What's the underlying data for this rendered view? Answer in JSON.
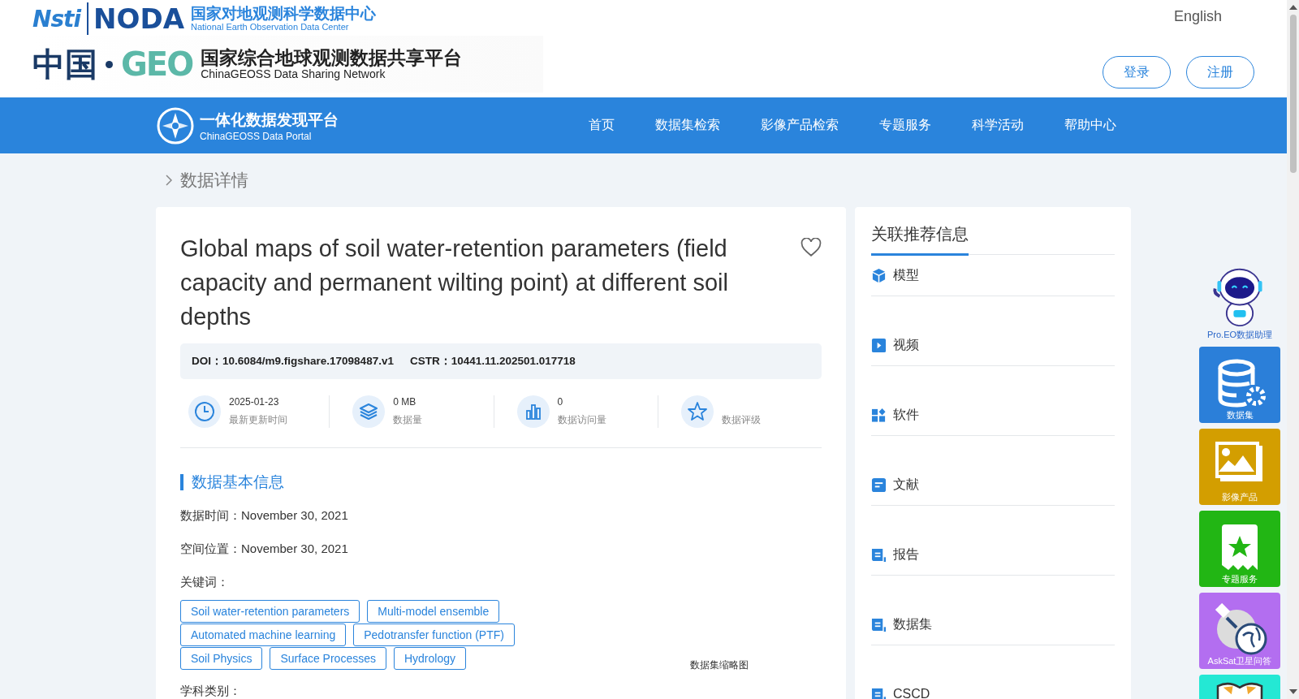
{
  "header": {
    "logos": {
      "nsti": "Nsti",
      "noda": "NODA",
      "noda_cn": "国家对地观测科学数据中心",
      "noda_en": "National Earth Observation Data Center",
      "china": "中国",
      "geo": "GEO",
      "geo_cn": "国家综合地球观测数据共享平台",
      "geo_en": "ChinaGEOSS Data Sharing Network"
    },
    "language": "English",
    "buttons": [
      "登录",
      "注册"
    ]
  },
  "nav": {
    "brand": {
      "title": "一体化数据发现平台",
      "subtitle": "ChinaGEOSS Data Portal"
    },
    "items": [
      "首页",
      "数据集检索",
      "影像产品检索",
      "专题服务",
      "科学活动",
      "帮助中心"
    ]
  },
  "breadcrumb": "数据详情",
  "dataset": {
    "title": "Global maps of soil water-retention parameters (field capacity and permanent wilting point) at different soil depths",
    "ids": [
      {
        "label": "DOI：",
        "value": "10.6084/m9.figshare.17098487.v1"
      },
      {
        "label": "CSTR：",
        "value": "10441.11.202501.017718"
      }
    ],
    "stats": [
      {
        "kind": "clock",
        "value": "2025-01-23",
        "label": "最新更新时间"
      },
      {
        "kind": "layers",
        "value": "0 MB",
        "label": "数据量"
      },
      {
        "kind": "bars",
        "value": "0",
        "label": "数据访问量"
      },
      {
        "kind": "star",
        "label": "数据评级"
      }
    ],
    "section_title": "数据基本信息",
    "fields": [
      {
        "label": "数据时间：",
        "value": "November 30, 2021"
      },
      {
        "label": "空间位置：",
        "value": "November 30, 2021"
      }
    ],
    "keywords_label": "关键词：",
    "keywords": [
      "Soil water-retention parameters",
      "Multi-model ensemble",
      "Automated machine learning",
      "Pedotransfer function (PTF)",
      "Soil Physics",
      "Surface Processes",
      "Hydrology"
    ],
    "thumbnail_caption": "数据集缩略图",
    "category_label": "学科类别："
  },
  "related": {
    "title": "关联推荐信息",
    "items": [
      {
        "kind": "cube",
        "label": "模型"
      },
      {
        "kind": "video",
        "label": "视频"
      },
      {
        "kind": "apps",
        "label": "软件"
      },
      {
        "kind": "doc",
        "label": "文献"
      },
      {
        "kind": "scroll",
        "label": "报告"
      },
      {
        "kind": "scroll",
        "label": "数据集"
      },
      {
        "kind": "scroll",
        "label": "CSCD"
      }
    ]
  },
  "float_tools": {
    "assistant": "Pro.EO数据助理",
    "tiles": [
      {
        "kind": "database",
        "label": "数据集",
        "color": "#2b7fd9"
      },
      {
        "kind": "image",
        "label": "影像产品",
        "color": "#d39e00"
      },
      {
        "kind": "bookmark",
        "label": "专题服务",
        "color": "#22b614"
      },
      {
        "kind": "satellite",
        "label": "AskSat卫星问答",
        "color": "#b36ef0"
      },
      {
        "kind": "book",
        "color": "#24e8d4"
      }
    ]
  }
}
